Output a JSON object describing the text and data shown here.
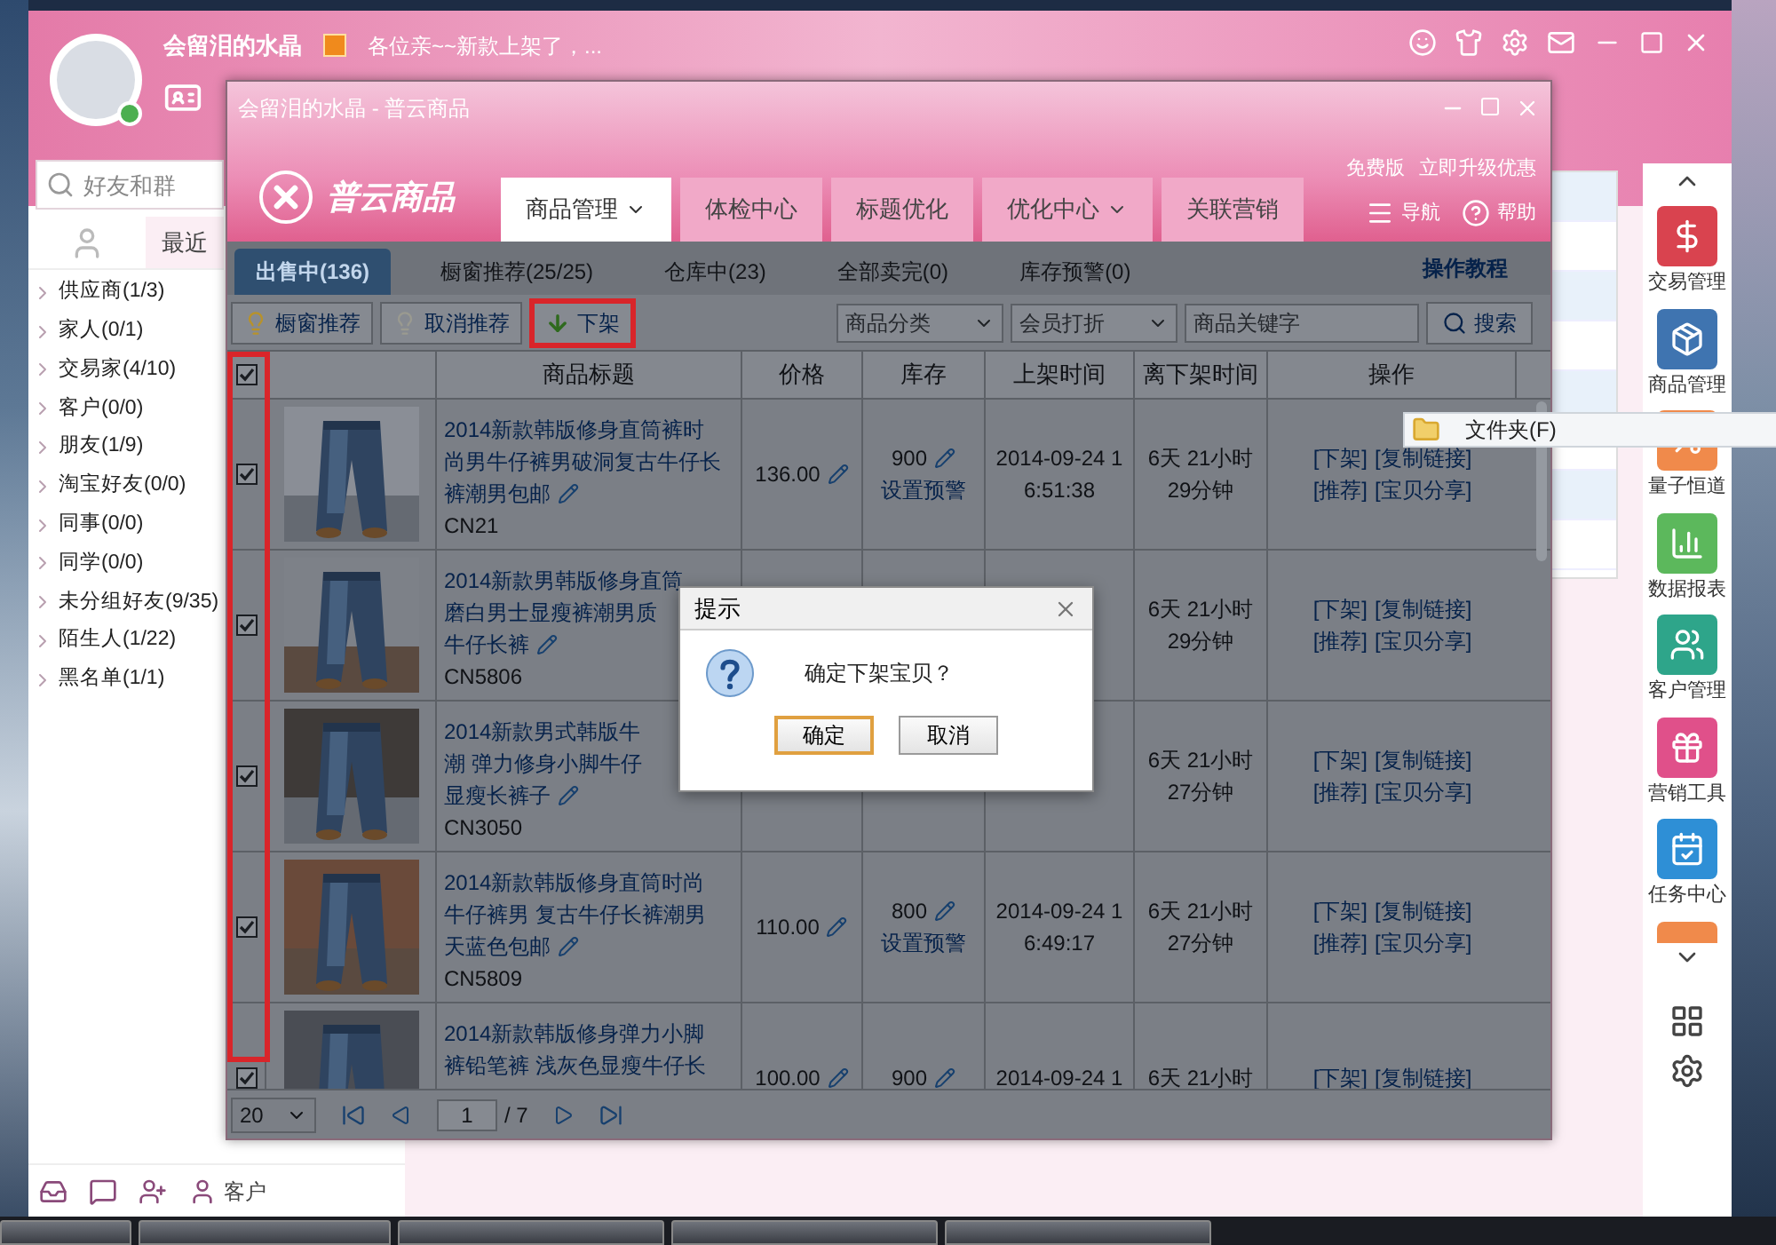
{
  "profile": {
    "name": "会留泪的水晶",
    "status": "各位亲~~新款上架了，..."
  },
  "search": {
    "placeholder": "好友和群"
  },
  "contact_tabs": [
    {
      "kind": "icon",
      "selected": true
    },
    {
      "kind": "text",
      "label": "最近",
      "selected": false
    }
  ],
  "groups": [
    {
      "label": "供应商(1/3)"
    },
    {
      "label": "家人(0/1)"
    },
    {
      "label": "交易家(4/10)"
    },
    {
      "label": "客户(0/0)"
    },
    {
      "label": "朋友(1/9)"
    },
    {
      "label": "淘宝好友(0/0)"
    },
    {
      "label": "同事(0/0)"
    },
    {
      "label": "同学(0/0)"
    },
    {
      "label": "未分组好友(9/35)"
    },
    {
      "label": "陌生人(1/22)"
    },
    {
      "label": "黑名单(1/1)"
    }
  ],
  "bottom_bar": {
    "label": "客户"
  },
  "window": {
    "title": "会留泪的水晶 - 普云商品",
    "logo": "普云商品",
    "edition": "免费版",
    "upgrade": "立即升级优惠",
    "nav_link": "导航",
    "help_link": "帮助"
  },
  "nav": [
    {
      "label": "商品管理",
      "dropdown": true,
      "selected": true
    },
    {
      "label": "体检中心",
      "dropdown": false,
      "selected": false
    },
    {
      "label": "标题优化",
      "dropdown": false,
      "selected": false
    },
    {
      "label": "优化中心",
      "dropdown": true,
      "selected": false
    },
    {
      "label": "关联营销",
      "dropdown": false,
      "selected": false
    }
  ],
  "status_tabs": [
    {
      "label": "出售中(136)",
      "selected": true
    },
    {
      "label": "橱窗推荐(25/25)",
      "selected": false
    },
    {
      "label": "仓库中(23)",
      "selected": false
    },
    {
      "label": "全部卖完(0)",
      "selected": false
    },
    {
      "label": "库存预警(0)",
      "selected": false
    }
  ],
  "tutorial": "操作教程",
  "toolbar": {
    "buttons": [
      {
        "label": "橱窗推荐",
        "kind": "bulb",
        "highlighted": false
      },
      {
        "label": "取消推荐",
        "kind": "bulb-off",
        "highlighted": false
      },
      {
        "label": "下架",
        "kind": "down",
        "highlighted": true
      }
    ],
    "filters": [
      {
        "placeholder": "商品分类"
      },
      {
        "placeholder": "会员打折"
      }
    ],
    "keyword": {
      "placeholder": "商品关键字"
    },
    "search": "搜索"
  },
  "table": {
    "select_all": true,
    "columns": [
      "商品标题",
      "价格",
      "库存",
      "上架时间",
      "离下架时间",
      "操作"
    ],
    "rows": [
      {
        "checked": true,
        "title_lines": [
          "2014新款韩版修身直筒裤时",
          "尚男牛仔裤男破洞复古牛仔长",
          "裤潮男包邮"
        ],
        "code": "CN21",
        "price": "136.00",
        "stock": "900",
        "alert": "设置预警",
        "listed": [
          "2014-09-24 1",
          "6:51:38"
        ],
        "remaining": [
          "6天 21小时",
          "29分钟"
        ],
        "actions": [
          "[下架]",
          "[复制链接]",
          "[推荐]",
          "[宝贝分享]"
        ]
      },
      {
        "checked": true,
        "title_lines": [
          "2014新款男韩版修身直筒",
          "磨白男士显瘦裤潮男质",
          "牛仔长裤"
        ],
        "code": "CN5806",
        "remaining": [
          "6天 21小时",
          "29分钟"
        ],
        "actions": [
          "[下架]",
          "[复制链接]",
          "[推荐]",
          "[宝贝分享]"
        ]
      },
      {
        "checked": true,
        "title_lines": [
          "2014新款男式韩版牛",
          "潮 弹力修身小脚牛仔",
          "显瘦长裤子"
        ],
        "code": "CN3050",
        "remaining": [
          "6天 21小时",
          "27分钟"
        ],
        "actions": [
          "[下架]",
          "[复制链接]",
          "[推荐]",
          "[宝贝分享]"
        ]
      },
      {
        "checked": true,
        "title_lines": [
          "2014新款韩版修身直筒时尚",
          "牛仔裤男 复古牛仔长裤潮男",
          "天蓝色包邮"
        ],
        "code": "CN5809",
        "price": "110.00",
        "stock": "800",
        "alert": "设置预警",
        "listed": [
          "2014-09-24 1",
          "6:49:17"
        ],
        "remaining": [
          "6天 21小时",
          "27分钟"
        ],
        "actions": [
          "[下架]",
          "[复制链接]",
          "[推荐]",
          "[宝贝分享]"
        ]
      },
      {
        "checked": true,
        "title_lines": [
          "2014新款韩版修身弹力小脚",
          "裤铅笔裤 浅灰色显瘦牛仔长"
        ],
        "price": "100.00",
        "stock": "900",
        "listed": [
          "2014-09-24 1"
        ],
        "remaining": [
          "6天 21小时"
        ],
        "actions": [
          "[下架]",
          "[复制链接]"
        ]
      }
    ]
  },
  "pager": {
    "page_size": "20",
    "page": "1",
    "total": "/ 7"
  },
  "dialog": {
    "title": "提示",
    "message": "确定下架宝贝？",
    "buttons": [
      {
        "label": "确定",
        "selected": true
      },
      {
        "label": "取消",
        "selected": false
      }
    ]
  },
  "context_menu": {
    "label": "文件夹(F)"
  },
  "side_tools": [
    {
      "label": "交易管理",
      "color": "#d9434f"
    },
    {
      "label": "商品管理",
      "color": "#3f74b0"
    },
    {
      "label": "量子恒道",
      "color": "#f08a4b"
    },
    {
      "label": "数据报表",
      "color": "#5cb85c"
    },
    {
      "label": "客户管理",
      "color": "#2ea58a"
    },
    {
      "label": "营销工具",
      "color": "#e0508a"
    },
    {
      "label": "任务中心",
      "color": "#2e8fd6"
    }
  ]
}
